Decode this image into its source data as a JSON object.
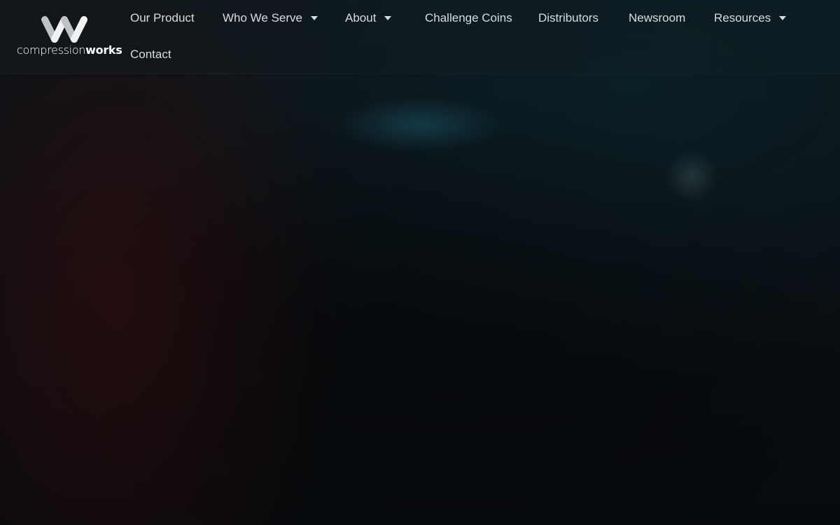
{
  "brand": {
    "name_light": "compression",
    "name_bold": "works",
    "icon": "w-logo-icon"
  },
  "nav": {
    "items": [
      {
        "label": "Our Product",
        "dropdown": false
      },
      {
        "label": "Who We Serve",
        "dropdown": true,
        "icon": "caret-down-icon"
      },
      {
        "label": "About",
        "dropdown": true,
        "icon": "caret-down-icon"
      },
      {
        "label": "Challenge Coins",
        "dropdown": false
      },
      {
        "label": "Distributors",
        "dropdown": false
      },
      {
        "label": "Newsroom",
        "dropdown": false
      },
      {
        "label": "Resources",
        "dropdown": true,
        "icon": "caret-down-icon"
      },
      {
        "label": "Contact",
        "dropdown": false
      }
    ]
  },
  "colors": {
    "nav_text": "#d6dde0",
    "background": "#0b0f14",
    "logo": "#ffffff"
  }
}
